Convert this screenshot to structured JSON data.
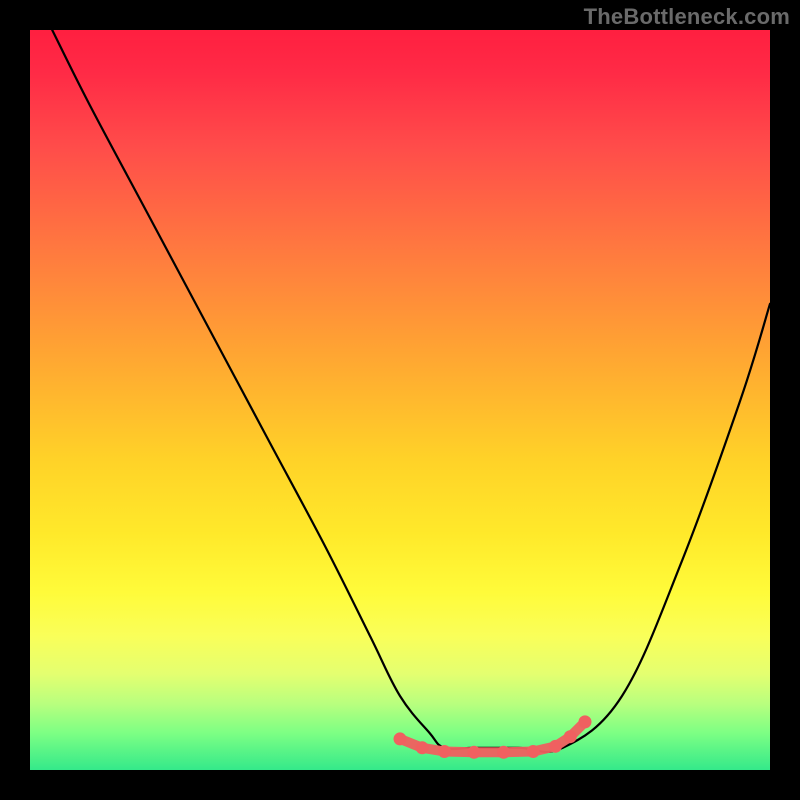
{
  "watermark": "TheBottleneck.com",
  "chart_data": {
    "type": "line",
    "title": "",
    "xlabel": "",
    "ylabel": "",
    "xlim": [
      0,
      100
    ],
    "ylim": [
      0,
      100
    ],
    "grid": false,
    "series": [
      {
        "name": "bottleneck-curve",
        "color": "#000000",
        "x": [
          3,
          8,
          16,
          24,
          32,
          40,
          46,
          50,
          54,
          56,
          60,
          66,
          72,
          80,
          88,
          96,
          100
        ],
        "y": [
          100,
          90,
          75,
          60,
          45,
          30,
          18,
          10,
          5,
          3,
          3,
          3,
          3,
          10,
          28,
          50,
          63
        ]
      },
      {
        "name": "optimal-band-markers",
        "color": "#f06060",
        "x": [
          50,
          53,
          56,
          60,
          64,
          68,
          71,
          73,
          75
        ],
        "y": [
          4.2,
          3.0,
          2.5,
          2.4,
          2.4,
          2.5,
          3.2,
          4.5,
          6.5
        ]
      }
    ]
  },
  "colors": {
    "black": "#000000",
    "markers": "#f06060",
    "gradient_top": "#ff1f40",
    "gradient_mid": "#ffd228",
    "gradient_bottom": "#34e98a"
  }
}
